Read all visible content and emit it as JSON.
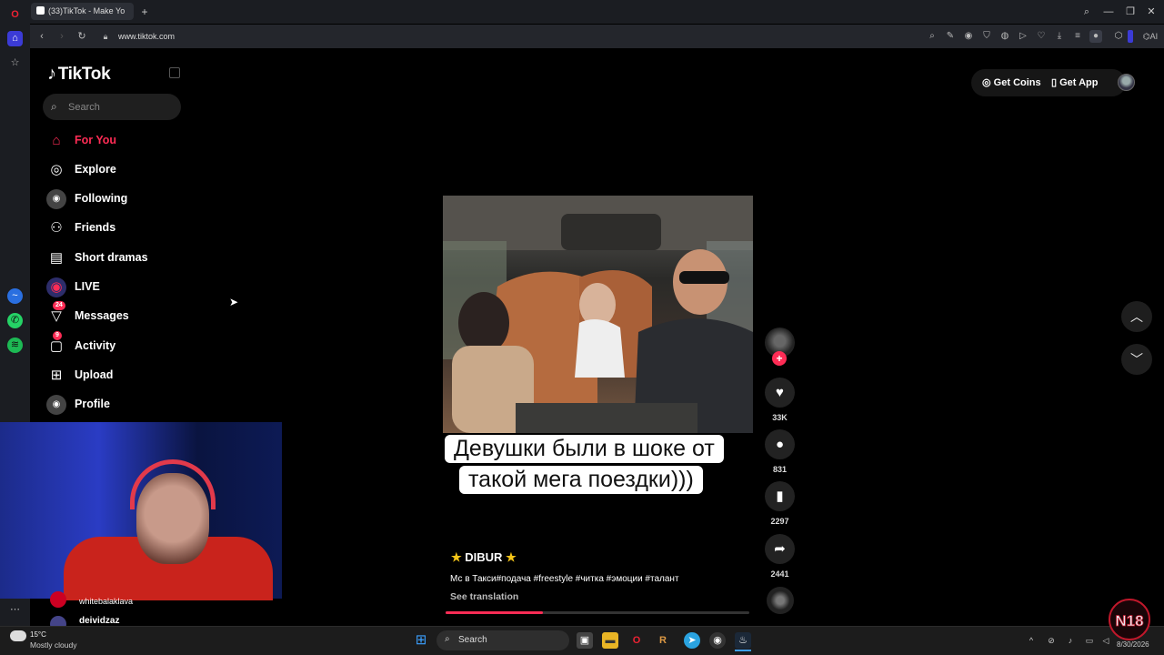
{
  "browser": {
    "tab_title": "(33)TikTok - Make Yo",
    "new_tab": "+",
    "url": "www.tiktok.com",
    "ai_label": "AI"
  },
  "tiktok": {
    "logo": "TikTok",
    "search_placeholder": "Search",
    "nav": [
      {
        "label": "For You",
        "icon": "home-icon",
        "active": true
      },
      {
        "label": "Explore",
        "icon": "compass-icon"
      },
      {
        "label": "Following",
        "icon": "following-avatar-icon"
      },
      {
        "label": "Friends",
        "icon": "friends-icon"
      },
      {
        "label": "Short dramas",
        "icon": "film-icon"
      },
      {
        "label": "LIVE",
        "icon": "live-icon"
      },
      {
        "label": "Messages",
        "icon": "send-icon",
        "badge": "24"
      },
      {
        "label": "Activity",
        "icon": "inbox-icon",
        "badge": "9"
      },
      {
        "label": "Upload",
        "icon": "plus-square-icon"
      },
      {
        "label": "Profile",
        "icon": "profile-avatar-icon"
      }
    ],
    "get_coins": "Get Coins",
    "get_app": "Get App",
    "video": {
      "caption_line1": "Девушки были в шоке от",
      "caption_line2": "такой мега поездки)))",
      "author": "DIBUR",
      "description": "Мс в Такси#подача #freestyle #читка #эмоции #талант",
      "see_translation": "See translation",
      "progress": 0.32,
      "likes": "33K",
      "comments": "831",
      "bookmarks": "2297",
      "shares": "2441"
    },
    "following_users": [
      "whitebalaklava",
      "deividzaz"
    ]
  },
  "taskbar": {
    "temperature": "15°C",
    "weather": "Mostly cloudy",
    "search_label": "Search",
    "date": "8/30/2026"
  },
  "colors": {
    "accent": "#fe2c55",
    "background": "#000000"
  }
}
